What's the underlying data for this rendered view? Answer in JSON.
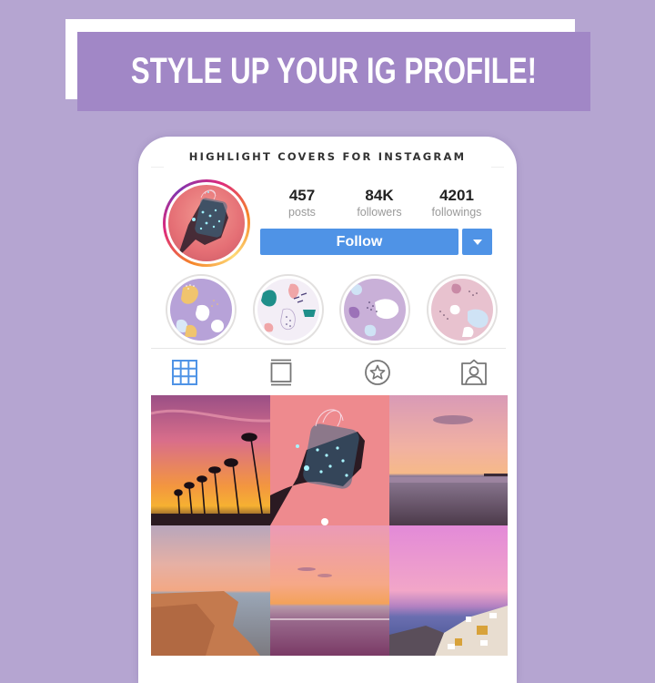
{
  "banner": {
    "title": "STYLE UP YOUR IG PROFILE!"
  },
  "phone": {
    "header": "HIGHLIGHT COVERS FOR INSTAGRAM",
    "profile": {
      "avatar": "mason-jar-fairy-lights-photo",
      "stats": [
        {
          "value": "457",
          "label": "posts"
        },
        {
          "value": "84K",
          "label": "followers"
        },
        {
          "value": "4201",
          "label": "followings"
        }
      ],
      "follow_label": "Follow",
      "dropdown_icon": "caret-down-icon"
    },
    "highlights": [
      {
        "name": "highlight-cover-1",
        "theme": "lavender-yellow-abstract"
      },
      {
        "name": "highlight-cover-2",
        "theme": "white-teal-pink-abstract"
      },
      {
        "name": "highlight-cover-3",
        "theme": "lilac-white-abstract"
      },
      {
        "name": "highlight-cover-4",
        "theme": "pink-blue-abstract"
      }
    ],
    "tabs": [
      {
        "icon": "grid-icon",
        "active": true
      },
      {
        "icon": "feed-icon",
        "active": false
      },
      {
        "icon": "star-icon",
        "active": false
      },
      {
        "icon": "tagged-icon",
        "active": false
      }
    ],
    "accent_color": "#4f93e6",
    "posts": [
      {
        "subject": "palm-trees-sunset"
      },
      {
        "subject": "fairy-lights-jar"
      },
      {
        "subject": "beach-pier-dusk"
      },
      {
        "subject": "coastal-cliffs"
      },
      {
        "subject": "pink-beach-sunset"
      },
      {
        "subject": "santorini-village"
      }
    ]
  }
}
